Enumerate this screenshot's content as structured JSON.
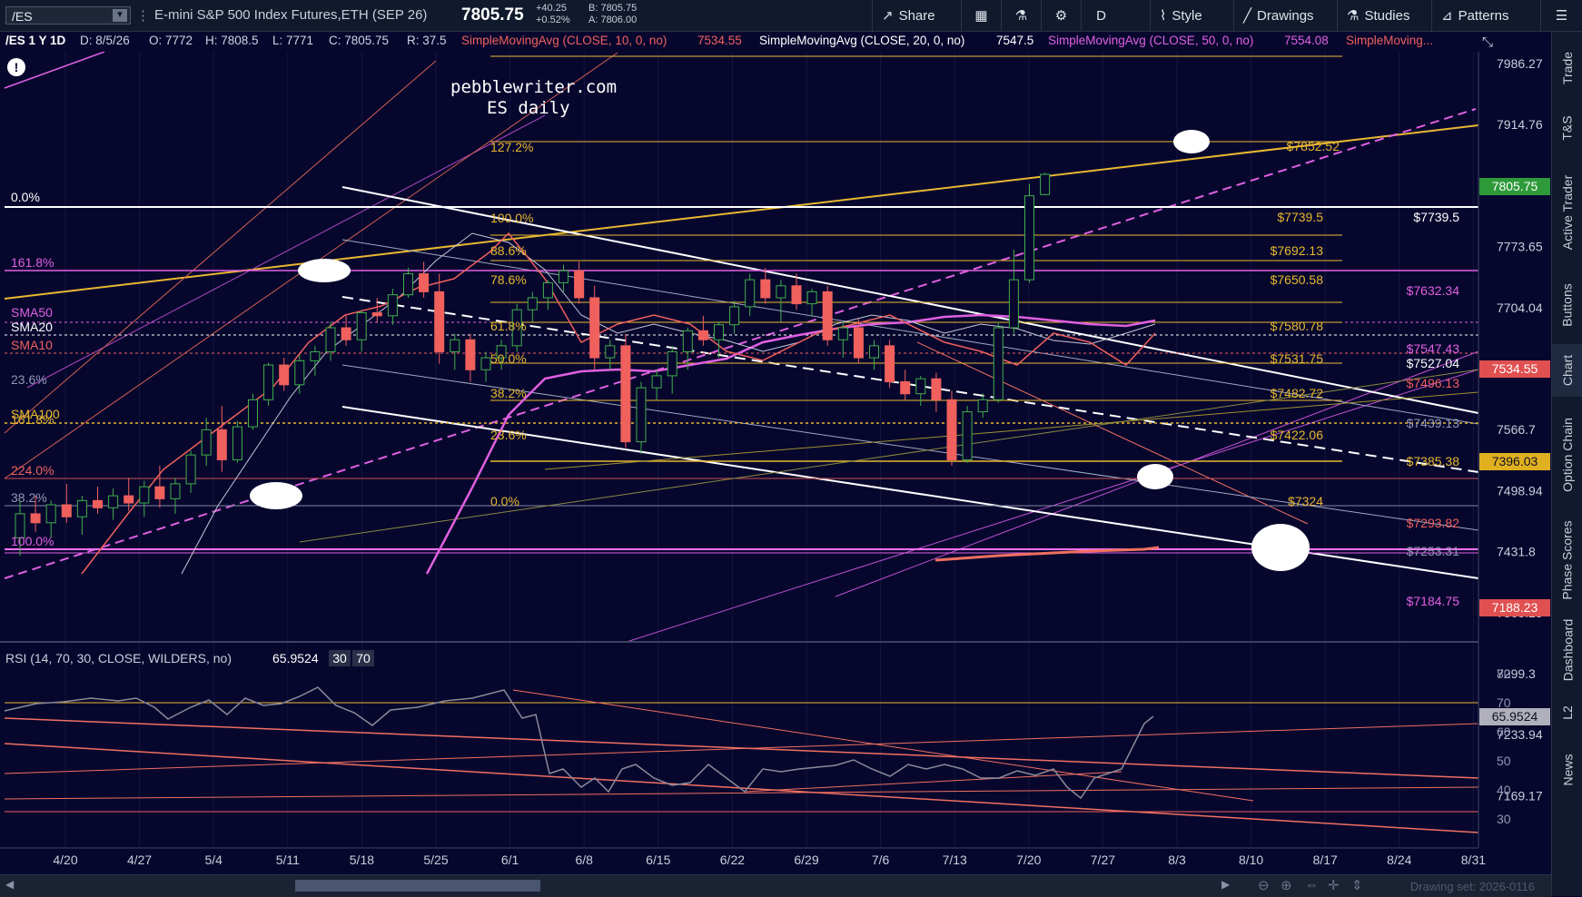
{
  "toolbar": {
    "symbol": "/ES",
    "description": "E-mini S&P 500 Index Futures,ETH (SEP 26)",
    "last": "7805.75",
    "change": "+40.25",
    "change_pct": "+0.52%",
    "bid": "B: 7805.75",
    "ask": "A: 7806.00",
    "share_label": "Share",
    "period_label": "D",
    "style_label": "Style",
    "drawings_label": "Drawings",
    "studies_label": "Studies",
    "patterns_label": "Patterns"
  },
  "infobar": {
    "chart_id": "/ES 1 Y 1D",
    "date": "D: 8/5/26",
    "open": "O: 7772",
    "high": "H: 7808.5",
    "low": "L: 7771",
    "close": "C: 7805.75",
    "range": "R: 37.5",
    "sma10_label": "SimpleMovingAvg (CLOSE, 10, 0, no)",
    "sma10_value": "7534.55",
    "sma20_label": "SimpleMovingAvg (CLOSE, 20, 0, no)",
    "sma20_value": "7547.5",
    "sma50_label": "SimpleMovingAvg (CLOSE, 50, 0, no)",
    "sma50_value": "7554.08",
    "sma_more": "SimpleMoving..."
  },
  "annotation": {
    "line1": "pebblewriter.com",
    "line2": "ES daily"
  },
  "price_axis": [
    "7986.27",
    "7914.76",
    "7843.89",
    "7773.65",
    "7704.04",
    "7635.06",
    "7566.7",
    "7498.94",
    "7431.8",
    "7365.25",
    "7299.3",
    "7233.94",
    "7169.17"
  ],
  "price_badges": {
    "last": "7805.75",
    "sma10": "7534.55",
    "sma100": "7396.03",
    "sma200": "7188.23"
  },
  "fib_left": {
    "pct0": "0.0%",
    "pct161": "161.8%",
    "pct236": "23.6%",
    "pct224": "224.0%",
    "pct382": "38.2%",
    "pct100": "100.0%",
    "pct1618b": "161.8%"
  },
  "fib_mid": {
    "p1272": "127.2%",
    "p100": "100.0%",
    "p886": "88.6%",
    "p786": "78.6%",
    "p618": "61.8%",
    "p50": "50.0%",
    "p382": "38.2%",
    "p236": "23.6%",
    "p0": "0.0%"
  },
  "levels_right": {
    "v7852": "$7852.52",
    "v7739": "$7739.5",
    "v7692": "$7692.13",
    "v7650": "$7650.58",
    "v7580": "$7580.78",
    "v7531": "$7531.75",
    "v7482": "$7482.72",
    "v7422": "$7422.06",
    "v7324": "$7324",
    "v7739w": "$7739.5",
    "v7632": "$7632.34",
    "v7547": "$7547.43",
    "v7527": "$7527.04",
    "v7496": "$7496.13",
    "v7439": "$7439.13",
    "v7385": "$7385.38",
    "v7293": "$7293.82",
    "v7253": "$7253.31",
    "v7184": "$7184.75"
  },
  "sma_tags": {
    "sma50": "SMA50",
    "sma20": "SMA20",
    "sma10": "SMA10",
    "sma100": "SMA100"
  },
  "rsi": {
    "label": "RSI (14, 70, 30, CLOSE, WILDERS, no)",
    "value": "65.9524",
    "ob": "30",
    "os": "70",
    "axis": [
      "80",
      "70",
      "60",
      "50",
      "40",
      "30"
    ]
  },
  "date_axis": [
    "4/20",
    "4/27",
    "5/4",
    "5/11",
    "5/18",
    "5/25",
    "6/1",
    "6/8",
    "6/15",
    "6/22",
    "6/29",
    "7/6",
    "7/13",
    "7/20",
    "7/27",
    "8/3",
    "8/10",
    "8/17",
    "8/24",
    "8/31"
  ],
  "right_tabs": [
    "Trade",
    "T&S",
    "Active Trader",
    "Buttons",
    "Chart",
    "Option Chain",
    "Phase Scores",
    "Dashboard",
    "L2",
    "News"
  ],
  "bottom_hint": "Drawing set: 2026-0116",
  "colors": {
    "background": "#07072e",
    "up": "#3fae49",
    "down": "#f0605d",
    "gold": "#e8b830",
    "magenta": "#e060e0",
    "last_badge": "#2e9a3a"
  },
  "chart_data": {
    "type": "candlestick",
    "ohlc_close_dates": [
      "4/20",
      "4/27",
      "5/4",
      "5/11",
      "5/18",
      "5/25",
      "6/1",
      "6/8",
      "6/15",
      "6/22",
      "6/29",
      "7/6",
      "7/13",
      "7/20",
      "7/27",
      "8/3"
    ],
    "candles": [
      {
        "o": 7200,
        "h": 7260,
        "l": 7170,
        "c": 7240
      },
      {
        "o": 7240,
        "h": 7270,
        "l": 7210,
        "c": 7225
      },
      {
        "o": 7225,
        "h": 7262,
        "l": 7200,
        "c": 7255
      },
      {
        "o": 7255,
        "h": 7290,
        "l": 7225,
        "c": 7235
      },
      {
        "o": 7235,
        "h": 7270,
        "l": 7205,
        "c": 7262
      },
      {
        "o": 7262,
        "h": 7285,
        "l": 7240,
        "c": 7250
      },
      {
        "o": 7250,
        "h": 7282,
        "l": 7230,
        "c": 7270
      },
      {
        "o": 7270,
        "h": 7300,
        "l": 7245,
        "c": 7258
      },
      {
        "o": 7258,
        "h": 7295,
        "l": 7235,
        "c": 7285
      },
      {
        "o": 7285,
        "h": 7320,
        "l": 7250,
        "c": 7265
      },
      {
        "o": 7265,
        "h": 7300,
        "l": 7240,
        "c": 7290
      },
      {
        "o": 7290,
        "h": 7345,
        "l": 7275,
        "c": 7338
      },
      {
        "o": 7338,
        "h": 7400,
        "l": 7320,
        "c": 7380
      },
      {
        "o": 7380,
        "h": 7420,
        "l": 7310,
        "c": 7330
      },
      {
        "o": 7330,
        "h": 7395,
        "l": 7325,
        "c": 7385
      },
      {
        "o": 7385,
        "h": 7440,
        "l": 7380,
        "c": 7430
      },
      {
        "o": 7430,
        "h": 7492,
        "l": 7420,
        "c": 7488
      },
      {
        "o": 7488,
        "h": 7500,
        "l": 7445,
        "c": 7455
      },
      {
        "o": 7455,
        "h": 7505,
        "l": 7440,
        "c": 7495
      },
      {
        "o": 7495,
        "h": 7520,
        "l": 7470,
        "c": 7510
      },
      {
        "o": 7510,
        "h": 7560,
        "l": 7495,
        "c": 7550
      },
      {
        "o": 7550,
        "h": 7570,
        "l": 7520,
        "c": 7530
      },
      {
        "o": 7530,
        "h": 7580,
        "l": 7510,
        "c": 7575
      },
      {
        "o": 7575,
        "h": 7600,
        "l": 7560,
        "c": 7570
      },
      {
        "o": 7570,
        "h": 7615,
        "l": 7555,
        "c": 7605
      },
      {
        "o": 7605,
        "h": 7650,
        "l": 7600,
        "c": 7640
      },
      {
        "o": 7640,
        "h": 7660,
        "l": 7600,
        "c": 7610
      },
      {
        "o": 7610,
        "h": 7640,
        "l": 7490,
        "c": 7510
      },
      {
        "o": 7510,
        "h": 7540,
        "l": 7480,
        "c": 7530
      },
      {
        "o": 7530,
        "h": 7540,
        "l": 7460,
        "c": 7480
      },
      {
        "o": 7480,
        "h": 7510,
        "l": 7460,
        "c": 7500
      },
      {
        "o": 7500,
        "h": 7530,
        "l": 7480,
        "c": 7520
      },
      {
        "o": 7520,
        "h": 7590,
        "l": 7510,
        "c": 7580
      },
      {
        "o": 7580,
        "h": 7610,
        "l": 7560,
        "c": 7600
      },
      {
        "o": 7600,
        "h": 7630,
        "l": 7580,
        "c": 7625
      },
      {
        "o": 7625,
        "h": 7655,
        "l": 7610,
        "c": 7645
      },
      {
        "o": 7645,
        "h": 7660,
        "l": 7590,
        "c": 7600
      },
      {
        "o": 7600,
        "h": 7620,
        "l": 7480,
        "c": 7500
      },
      {
        "o": 7500,
        "h": 7530,
        "l": 7480,
        "c": 7520
      },
      {
        "o": 7520,
        "h": 7540,
        "l": 7350,
        "c": 7360
      },
      {
        "o": 7360,
        "h": 7460,
        "l": 7340,
        "c": 7450
      },
      {
        "o": 7450,
        "h": 7480,
        "l": 7430,
        "c": 7470
      },
      {
        "o": 7470,
        "h": 7520,
        "l": 7440,
        "c": 7510
      },
      {
        "o": 7510,
        "h": 7550,
        "l": 7480,
        "c": 7545
      },
      {
        "o": 7545,
        "h": 7570,
        "l": 7520,
        "c": 7530
      },
      {
        "o": 7530,
        "h": 7560,
        "l": 7500,
        "c": 7555
      },
      {
        "o": 7555,
        "h": 7595,
        "l": 7540,
        "c": 7585
      },
      {
        "o": 7585,
        "h": 7640,
        "l": 7570,
        "c": 7630
      },
      {
        "o": 7630,
        "h": 7650,
        "l": 7590,
        "c": 7600
      },
      {
        "o": 7600,
        "h": 7630,
        "l": 7560,
        "c": 7620
      },
      {
        "o": 7620,
        "h": 7640,
        "l": 7580,
        "c": 7590
      },
      {
        "o": 7590,
        "h": 7615,
        "l": 7570,
        "c": 7610
      },
      {
        "o": 7610,
        "h": 7620,
        "l": 7520,
        "c": 7530
      },
      {
        "o": 7530,
        "h": 7560,
        "l": 7500,
        "c": 7550
      },
      {
        "o": 7550,
        "h": 7565,
        "l": 7490,
        "c": 7500
      },
      {
        "o": 7500,
        "h": 7530,
        "l": 7480,
        "c": 7520
      },
      {
        "o": 7520,
        "h": 7530,
        "l": 7450,
        "c": 7460
      },
      {
        "o": 7460,
        "h": 7480,
        "l": 7430,
        "c": 7440
      },
      {
        "o": 7440,
        "h": 7470,
        "l": 7420,
        "c": 7465
      },
      {
        "o": 7465,
        "h": 7475,
        "l": 7410,
        "c": 7430
      },
      {
        "o": 7430,
        "h": 7445,
        "l": 7320,
        "c": 7330
      },
      {
        "o": 7330,
        "h": 7420,
        "l": 7325,
        "c": 7410
      },
      {
        "o": 7410,
        "h": 7440,
        "l": 7400,
        "c": 7430
      },
      {
        "o": 7430,
        "h": 7560,
        "l": 7425,
        "c": 7550
      },
      {
        "o": 7550,
        "h": 7680,
        "l": 7540,
        "c": 7630
      },
      {
        "o": 7630,
        "h": 7790,
        "l": 7625,
        "c": 7770
      },
      {
        "o": 7772,
        "h": 7808.5,
        "l": 7771,
        "c": 7805.75
      }
    ],
    "ylim": [
      7140,
      8010
    ]
  }
}
